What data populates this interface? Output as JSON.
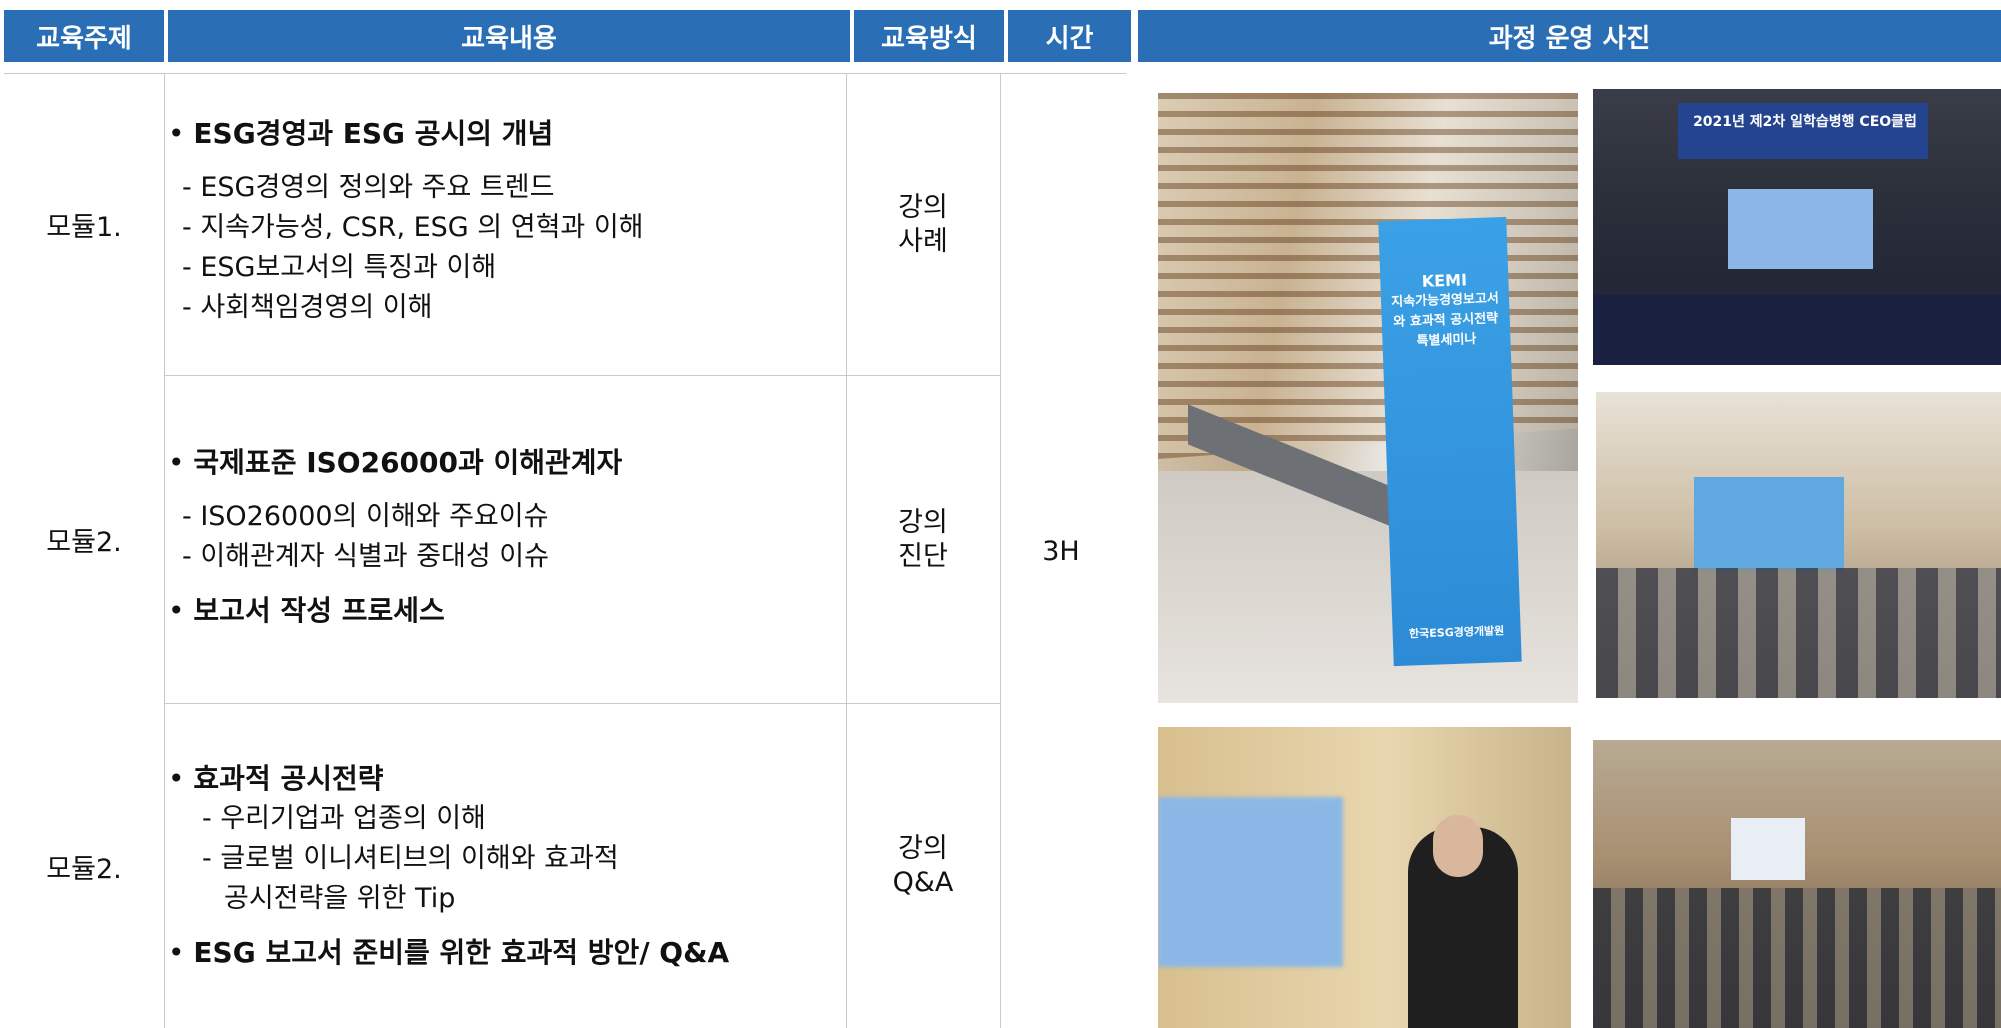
{
  "header": {
    "col_topic": "교육주제",
    "col_content": "교육내용",
    "col_method": "교육방식",
    "col_time": "시간",
    "col_photos": "과정 운영 사진"
  },
  "rows": [
    {
      "module": "모듈1.",
      "method_line1": "강의",
      "method_line2": "사례",
      "bullet1": "ESG경영과 ESG 공시의 개념",
      "items": [
        "- ESG경영의 정의와 주요 트렌드",
        "- 지속가능성, CSR, ESG 의 연혁과 이해",
        "- ESG보고서의 특징과 이해",
        "- 사회책임경영의 이해"
      ]
    },
    {
      "module": "모듈2.",
      "method_line1": "강의",
      "method_line2": "진단",
      "bullet1": "국제표준 ISO26000과 이해관계자",
      "items": [
        "- ISO26000의 이해와 주요이슈",
        "- 이해관계자 식별과 중대성 이슈"
      ],
      "bullet2": "보고서 작성 프로세스"
    },
    {
      "module": "모듈2.",
      "method_line1": "강의",
      "method_line2": "Q&A",
      "bullet1": "효과적 공시전략",
      "items": [
        "- 우리기업과 업종의 이해",
        "- 글로벌 이니셔티브의 이해와 효과적",
        "공시전략을 위한 Tip"
      ],
      "bullet2": "ESG 보고서 준비를 위한 효과적 방안/ Q&A"
    }
  ],
  "time_value": "3H",
  "photos": {
    "banner_lines": [
      "KEMI",
      "지속가능경영보고서",
      "와 효과적 공시전략",
      "특별세미나"
    ],
    "banner_logo": "한국ESG경영개발원",
    "stage_title": "2021년 제2차 일학습병행 CEO클럽"
  }
}
